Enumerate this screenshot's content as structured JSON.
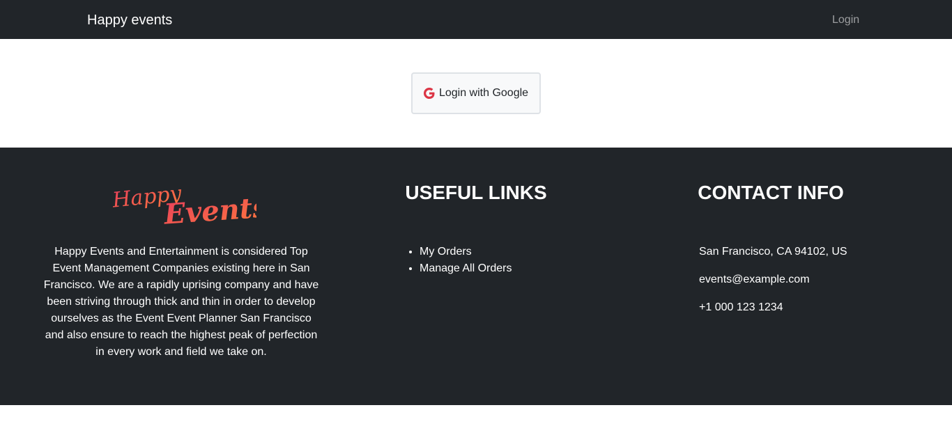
{
  "navbar": {
    "brand": "Happy events",
    "login_link": "Login"
  },
  "login": {
    "google_button_label": "Login with Google",
    "google_icon": "google-icon",
    "google_icon_color": "#dc3545"
  },
  "footer": {
    "logo_text_1": "Happy",
    "logo_text_2": "Events",
    "logo_colors": [
      "#e83e5c",
      "#ff7a3d"
    ],
    "about": "Happy Events and Entertainment is considered Top Event Management Companies existing here in San Francisco. We are a rapidly uprising company and have been striving through thick and thin in order to develop ourselves as the Event Event Planner San Francisco and also ensure to reach the highest peak of perfection in every work and field we take on.",
    "useful_links": {
      "title": "USEFUL LINKS",
      "items": [
        {
          "label": "My Orders"
        },
        {
          "label": "Manage All Orders"
        }
      ]
    },
    "contact": {
      "title": "CONTACT INFO",
      "address": "San Francisco, CA 94102, US",
      "email": "events@example.com",
      "phone": "+1 000 123 1234"
    }
  }
}
